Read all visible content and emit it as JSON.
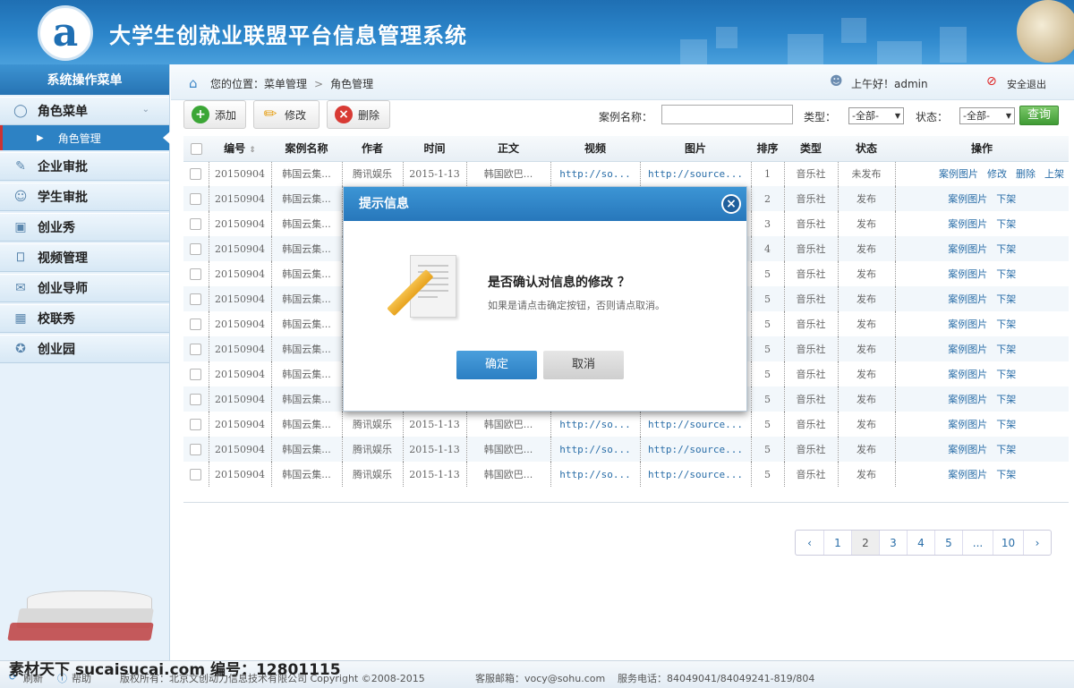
{
  "header": {
    "logo_letter": "a",
    "title": "大学生创就业联盟平台信息管理系统"
  },
  "sidebar": {
    "title": "系统操作菜单",
    "items": [
      {
        "label": "角色菜单",
        "icon": "user-icon"
      },
      {
        "label": "企业审批",
        "icon": "edit-icon"
      },
      {
        "label": "学生审批",
        "icon": "users-icon"
      },
      {
        "label": "创业秀",
        "icon": "presentation-icon"
      },
      {
        "label": "视频管理",
        "icon": "tv-icon"
      },
      {
        "label": "创业导师",
        "icon": "megaphone-icon"
      },
      {
        "label": "校联秀",
        "icon": "grid-icon"
      },
      {
        "label": "创业园",
        "icon": "badge-icon"
      }
    ],
    "sub_item": "角色管理"
  },
  "topbar": {
    "location_label": "您的位置：",
    "crumb1": "菜单管理",
    "crumb2": "角色管理",
    "greeting": "上午好！admin",
    "logout": "安全退出"
  },
  "toolbar": {
    "add": "添加",
    "edit": "修改",
    "delete": "删除",
    "case_name_label": "案例名称：",
    "type_label": "类型：",
    "type_value": "-全部-",
    "status_label": "状态：",
    "status_value": "-全部-",
    "query": "查询"
  },
  "table": {
    "headers": [
      "编号",
      "案例名称",
      "作者",
      "时间",
      "正文",
      "视频",
      "图片",
      "排序",
      "类型",
      "状态",
      "操作"
    ],
    "rows": [
      {
        "id": "20150904",
        "name": "韩国云集...",
        "author": "腾讯娱乐",
        "time": "2015-1-13",
        "body": "韩国欧巴...",
        "video": "http://so...",
        "image": "http://source...",
        "order": "1",
        "type": "音乐社",
        "status": "未发布",
        "ops": [
          "案例图片",
          "修改",
          "删除",
          "上架"
        ]
      },
      {
        "id": "20150904",
        "name": "韩国云集...",
        "author": "",
        "time": "",
        "body": "",
        "video": "",
        "image": "",
        "order": "2",
        "type": "音乐社",
        "status": "发布",
        "ops": [
          "案例图片",
          "下架"
        ]
      },
      {
        "id": "20150904",
        "name": "韩国云集...",
        "author": "",
        "time": "",
        "body": "",
        "video": "",
        "image": "",
        "order": "3",
        "type": "音乐社",
        "status": "发布",
        "ops": [
          "案例图片",
          "下架"
        ]
      },
      {
        "id": "20150904",
        "name": "韩国云集...",
        "author": "",
        "time": "",
        "body": "",
        "video": "",
        "image": "",
        "order": "4",
        "type": "音乐社",
        "status": "发布",
        "ops": [
          "案例图片",
          "下架"
        ]
      },
      {
        "id": "20150904",
        "name": "韩国云集...",
        "author": "",
        "time": "",
        "body": "",
        "video": "",
        "image": "",
        "order": "5",
        "type": "音乐社",
        "status": "发布",
        "ops": [
          "案例图片",
          "下架"
        ]
      },
      {
        "id": "20150904",
        "name": "韩国云集...",
        "author": "",
        "time": "",
        "body": "",
        "video": "",
        "image": "",
        "order": "5",
        "type": "音乐社",
        "status": "发布",
        "ops": [
          "案例图片",
          "下架"
        ]
      },
      {
        "id": "20150904",
        "name": "韩国云集...",
        "author": "",
        "time": "",
        "body": "",
        "video": "",
        "image": "",
        "order": "5",
        "type": "音乐社",
        "status": "发布",
        "ops": [
          "案例图片",
          "下架"
        ]
      },
      {
        "id": "20150904",
        "name": "韩国云集...",
        "author": "",
        "time": "",
        "body": "",
        "video": "",
        "image": "",
        "order": "5",
        "type": "音乐社",
        "status": "发布",
        "ops": [
          "案例图片",
          "下架"
        ]
      },
      {
        "id": "20150904",
        "name": "韩国云集...",
        "author": "",
        "time": "",
        "body": "",
        "video": "",
        "image": "",
        "order": "5",
        "type": "音乐社",
        "status": "发布",
        "ops": [
          "案例图片",
          "下架"
        ]
      },
      {
        "id": "20150904",
        "name": "韩国云集...",
        "author": "",
        "time": "",
        "body": "",
        "video": "",
        "image": "",
        "order": "5",
        "type": "音乐社",
        "status": "发布",
        "ops": [
          "案例图片",
          "下架"
        ]
      },
      {
        "id": "20150904",
        "name": "韩国云集...",
        "author": "腾讯娱乐",
        "time": "2015-1-13",
        "body": "韩国欧巴...",
        "video": "http://so...",
        "image": "http://source...",
        "order": "5",
        "type": "音乐社",
        "status": "发布",
        "ops": [
          "案例图片",
          "下架"
        ]
      },
      {
        "id": "20150904",
        "name": "韩国云集...",
        "author": "腾讯娱乐",
        "time": "2015-1-13",
        "body": "韩国欧巴...",
        "video": "http://so...",
        "image": "http://source...",
        "order": "5",
        "type": "音乐社",
        "status": "发布",
        "ops": [
          "案例图片",
          "下架"
        ]
      },
      {
        "id": "20150904",
        "name": "韩国云集...",
        "author": "腾讯娱乐",
        "time": "2015-1-13",
        "body": "韩国欧巴...",
        "video": "http://so...",
        "image": "http://source...",
        "order": "5",
        "type": "音乐社",
        "status": "发布",
        "ops": [
          "案例图片",
          "下架"
        ]
      }
    ]
  },
  "pager": {
    "prev": "‹",
    "pages": [
      "1",
      "2",
      "3",
      "4",
      "5",
      "...",
      "10"
    ],
    "current": "2",
    "next": "›"
  },
  "footer": {
    "refresh": "刷新",
    "help": "帮助",
    "copyright": "版权所有：北京文创动力信息技术有限公司 Copyright ©2008-2015",
    "email": "客服邮箱：vocy@sohu.com",
    "phone": "服务电话：84049041/84049241-819/804"
  },
  "watermark": "素材天下 sucaisucai.com  编号：12801115",
  "dialog": {
    "title": "提示信息",
    "question": "是否确认对信息的修改 ？",
    "hint": "如果是请点击确定按钮，否则请点取消。",
    "ok": "确定",
    "cancel": "取消"
  }
}
